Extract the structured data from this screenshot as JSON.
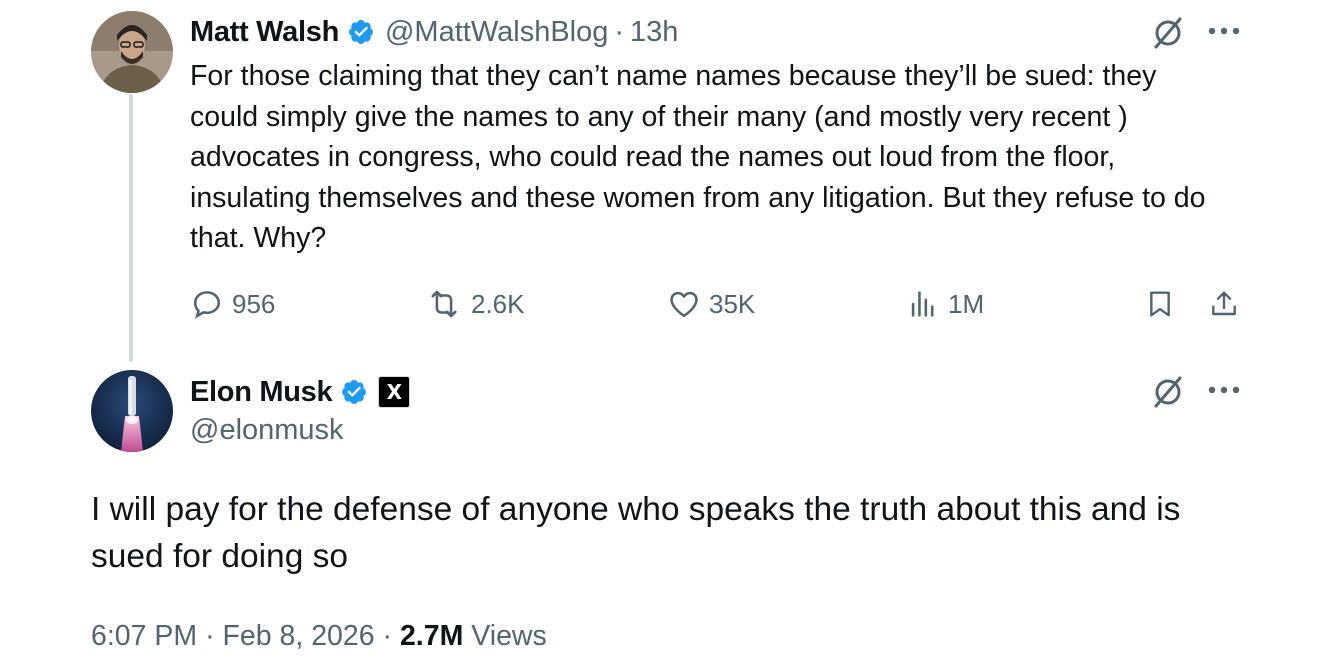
{
  "quoted_tweet": {
    "author_name": "Matt Walsh",
    "verified_icon": "verified-badge-icon",
    "handle": "@MattWalshBlog",
    "separator": "·",
    "age": "13h",
    "text": "For those claiming that they can’t name names because they’ll be sued: they could simply give the names to any of their many (and mostly very recent ) advocates in congress, who could read the names out loud from the floor, insulating themselves and these women from any litigation. But they refuse to do that. Why?",
    "metrics": {
      "replies": "956",
      "reposts": "2.6K",
      "likes": "35K",
      "views": "1M"
    }
  },
  "main_tweet": {
    "author_name": "Elon Musk",
    "verified_icon": "verified-badge-icon",
    "affiliate_badge": "X",
    "handle": "@elonmusk",
    "text": "I will pay for the defense of anyone who speaks the truth about this and is sued for doing so",
    "time": "6:07 PM",
    "separator1": "·",
    "date": "Feb 8, 2026",
    "separator2": "·",
    "views_count": "2.7M",
    "views_label": "Views"
  },
  "colors": {
    "text": "#0f1419",
    "secondary": "#536471",
    "verified_blue": "#1d9bf0",
    "thread_line": "#cfd9de"
  }
}
